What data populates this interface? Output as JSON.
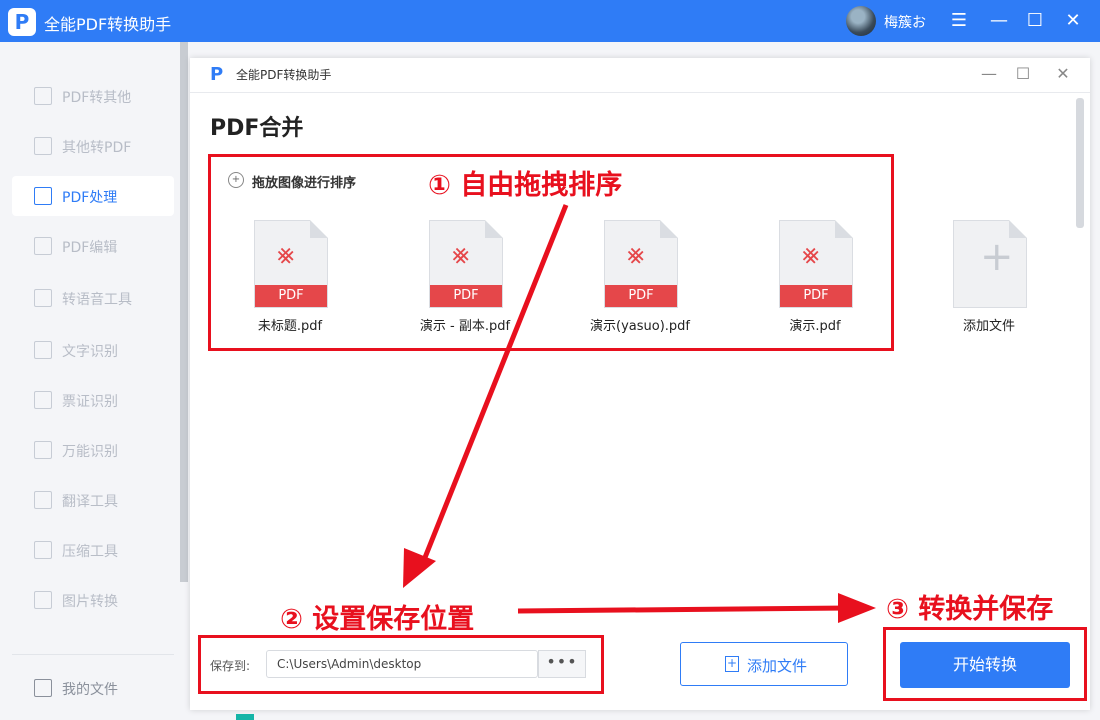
{
  "app": {
    "title": "全能PDF转换助手",
    "logo": "P",
    "user_name": "梅簇お"
  },
  "window_controls": {
    "menu": "☰",
    "min": "—",
    "max": "☐",
    "close": "✕"
  },
  "sidebar": {
    "items": [
      {
        "label": "PDF转其他",
        "icon": "pdf-convert-icon"
      },
      {
        "label": "其他转PDF",
        "icon": "to-pdf-icon"
      },
      {
        "label": "PDF处理",
        "icon": "pdf-process-icon"
      },
      {
        "label": "PDF编辑",
        "icon": "pdf-edit-icon"
      },
      {
        "label": "转语音工具",
        "icon": "speech-icon"
      },
      {
        "label": "文字识别",
        "icon": "ocr-icon"
      },
      {
        "label": "票证识别",
        "icon": "ticket-icon"
      },
      {
        "label": "万能识别",
        "icon": "universal-icon"
      },
      {
        "label": "翻译工具",
        "icon": "translate-icon"
      },
      {
        "label": "压缩工具",
        "icon": "compress-icon"
      },
      {
        "label": "图片转换",
        "icon": "image-icon"
      },
      {
        "label": "我的文件",
        "icon": "my-files-icon"
      }
    ],
    "active_index": 2
  },
  "dialog": {
    "title": "全能PDF转换助手",
    "heading": "PDF合并",
    "drag_hint": "拖放图像进行排序",
    "files": [
      {
        "name": "未标题.pdf",
        "badge": "PDF"
      },
      {
        "name": "演示 - 副本.pdf",
        "badge": "PDF"
      },
      {
        "name": "演示(yasuo).pdf",
        "badge": "PDF"
      },
      {
        "name": "演示.pdf",
        "badge": "PDF"
      }
    ],
    "add_tile": {
      "label": "添加文件",
      "icon": "+"
    },
    "save_label": "保存到:",
    "save_path": "C:\\Users\\Admin\\desktop",
    "browse": "•••",
    "add_button": "添加文件",
    "start_button": "开始转换"
  },
  "annotations": {
    "step1": "① 自由拖拽排序",
    "step2": "② 设置保存位置",
    "step3": "③ 转换并保存",
    "color": "#e8101e"
  },
  "colors": {
    "primary": "#2f7cf6",
    "pdf_red": "#e5474a"
  }
}
